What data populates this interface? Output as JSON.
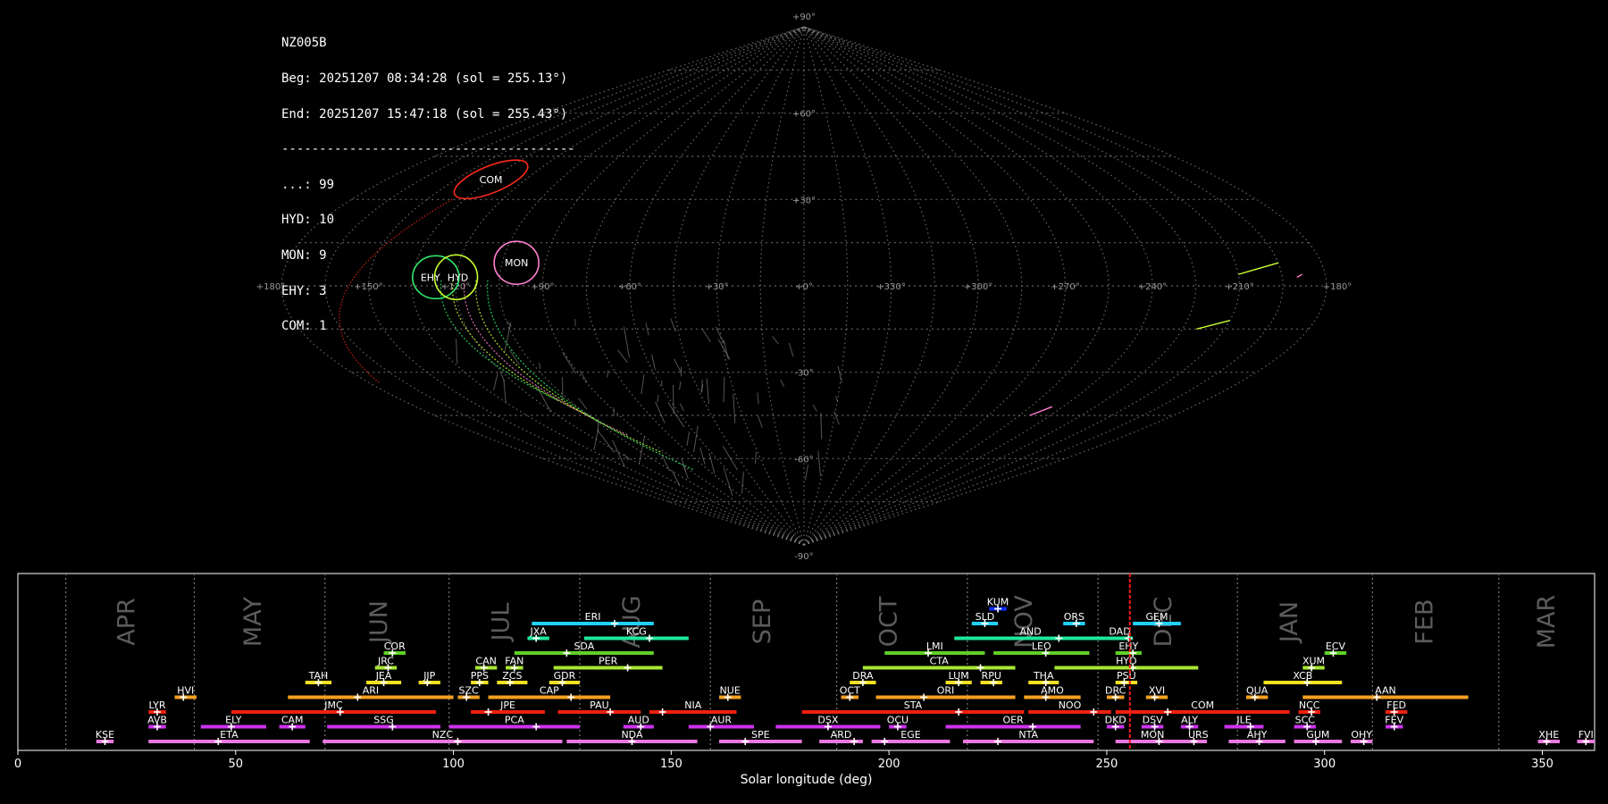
{
  "info": {
    "station": "NZ005B",
    "begin": "Beg: 20251207 08:34:28 (sol = 255.13°)",
    "end": "End: 20251207 15:47:18 (sol = 255.43°)",
    "separator": "---------------------------------------",
    "counts": [
      {
        "label": "...:",
        "value": "99"
      },
      {
        "label": "HYD:",
        "value": "10"
      },
      {
        "label": "MON:",
        "value": "9"
      },
      {
        "label": "EHY:",
        "value": "3"
      },
      {
        "label": "COM:",
        "value": "1"
      }
    ]
  },
  "sky_map": {
    "projection": "sinusoidal",
    "lon_labels": [
      "+180°",
      "+150°",
      "+120°",
      "+90°",
      "+60°",
      "+30°",
      "+0°",
      "+330°",
      "+300°",
      "+270°",
      "+240°",
      "+210°",
      "+180°"
    ],
    "lat_labels": [
      "+90°",
      "+60°",
      "+30°",
      "-30°",
      "-60°",
      "-90°"
    ],
    "radiants": [
      {
        "code": "COM",
        "lon": 135,
        "lat": 37,
        "color": "#ff2a1a"
      },
      {
        "code": "EHY",
        "lon": 127,
        "lat": 3,
        "color": "#2ee86a"
      },
      {
        "code": "HYD",
        "lon": 120,
        "lat": 3,
        "color": "#c8ff30"
      },
      {
        "code": "MON",
        "lon": 100,
        "lat": 8,
        "color": "#ff80d0"
      }
    ]
  },
  "chart_data": {
    "type": "bar",
    "xlabel": "Solar longitude (deg)",
    "xlim": [
      0,
      362
    ],
    "xticks": [
      0,
      50,
      100,
      150,
      200,
      250,
      300,
      350
    ],
    "current_sol": 255.3,
    "months": [
      {
        "name": "APR",
        "center": 25
      },
      {
        "name": "MAY",
        "center": 54
      },
      {
        "name": "JUN",
        "center": 83
      },
      {
        "name": "JUL",
        "center": 111
      },
      {
        "name": "AUG",
        "center": 141
      },
      {
        "name": "SEP",
        "center": 171
      },
      {
        "name": "OCT",
        "center": 200
      },
      {
        "name": "NOV",
        "center": 231
      },
      {
        "name": "DEC",
        "center": 263
      },
      {
        "name": "JAN",
        "center": 292
      },
      {
        "name": "FEB",
        "center": 323
      },
      {
        "name": "MAR",
        "center": 351
      }
    ],
    "month_boundaries": [
      11,
      40.5,
      70.5,
      99,
      129,
      159,
      188,
      218,
      248,
      280,
      311,
      340
    ],
    "showers": [
      {
        "code": "KUM",
        "start": 223,
        "end": 227,
        "peak": 225,
        "row": 9,
        "color": "#1030ff"
      },
      {
        "code": "ERI",
        "start": 118,
        "end": 146,
        "peak": 137,
        "row": 8,
        "color": "#22d0ff"
      },
      {
        "code": "SLD",
        "start": 219,
        "end": 225,
        "peak": 222,
        "row": 8,
        "color": "#22d0ff"
      },
      {
        "code": "ORS",
        "start": 240,
        "end": 245,
        "peak": 243,
        "row": 8,
        "color": "#22d0ff"
      },
      {
        "code": "GEM",
        "start": 256,
        "end": 267,
        "peak": 262,
        "row": 8,
        "color": "#22d0ff"
      },
      {
        "code": "JXA",
        "start": 117,
        "end": 122,
        "peak": 119,
        "row": 7,
        "color": "#20e89a"
      },
      {
        "code": "KCG",
        "start": 130,
        "end": 154,
        "peak": 145,
        "row": 7,
        "color": "#20e89a"
      },
      {
        "code": "AND",
        "start": 215,
        "end": 250,
        "peak": 239,
        "row": 7,
        "color": "#20e89a"
      },
      {
        "code": "DAD",
        "start": 250,
        "end": 256,
        "peak": 255,
        "row": 7,
        "color": "#20e89a"
      },
      {
        "code": "COR",
        "start": 84,
        "end": 89,
        "peak": 86,
        "row": 6,
        "color": "#60d028"
      },
      {
        "code": "SDA",
        "start": 114,
        "end": 146,
        "peak": 126,
        "row": 6,
        "color": "#60d028"
      },
      {
        "code": "LMI",
        "start": 199,
        "end": 222,
        "peak": 209,
        "row": 6,
        "color": "#60d028"
      },
      {
        "code": "LEO",
        "start": 224,
        "end": 246,
        "peak": 236,
        "row": 6,
        "color": "#60d028"
      },
      {
        "code": "EHY",
        "start": 252,
        "end": 258,
        "peak": 256,
        "row": 6,
        "color": "#60d028"
      },
      {
        "code": "ECV",
        "start": 300,
        "end": 305,
        "peak": 302,
        "row": 6,
        "color": "#60d028"
      },
      {
        "code": "JRC",
        "start": 82,
        "end": 87,
        "peak": 85,
        "row": 5,
        "color": "#a8e830"
      },
      {
        "code": "CAN",
        "start": 105,
        "end": 110,
        "peak": 107,
        "row": 5,
        "color": "#a8e830"
      },
      {
        "code": "FAN",
        "start": 112,
        "end": 116,
        "peak": 114,
        "row": 5,
        "color": "#a8e830"
      },
      {
        "code": "PER",
        "start": 123,
        "end": 148,
        "peak": 140,
        "row": 5,
        "color": "#a8e830"
      },
      {
        "code": "CTA",
        "start": 194,
        "end": 229,
        "peak": 221,
        "row": 5,
        "color": "#a8e830"
      },
      {
        "code": "HYD",
        "start": 238,
        "end": 271,
        "peak": 256,
        "row": 5,
        "color": "#a8e830"
      },
      {
        "code": "XUM",
        "start": 295,
        "end": 300,
        "peak": 297,
        "row": 5,
        "color": "#a8e830"
      },
      {
        "code": "TAH",
        "start": 66,
        "end": 72,
        "peak": 69,
        "row": 4,
        "color": "#f0e020"
      },
      {
        "code": "JEA",
        "start": 80,
        "end": 88,
        "peak": 84,
        "row": 4,
        "color": "#f0e020"
      },
      {
        "code": "JIP",
        "start": 92,
        "end": 97,
        "peak": 94,
        "row": 4,
        "color": "#f0e020"
      },
      {
        "code": "PPS",
        "start": 104,
        "end": 108,
        "peak": 106,
        "row": 4,
        "color": "#f0e020"
      },
      {
        "code": "ZCS",
        "start": 110,
        "end": 117,
        "peak": 113,
        "row": 4,
        "color": "#f0e020"
      },
      {
        "code": "GDR",
        "start": 122,
        "end": 129,
        "peak": 125,
        "row": 4,
        "color": "#f0e020"
      },
      {
        "code": "DRA",
        "start": 191,
        "end": 197,
        "peak": 194,
        "row": 4,
        "color": "#f0e020"
      },
      {
        "code": "LUM",
        "start": 213,
        "end": 219,
        "peak": 216,
        "row": 4,
        "color": "#f0e020"
      },
      {
        "code": "RPU",
        "start": 221,
        "end": 226,
        "peak": 224,
        "row": 4,
        "color": "#f0e020"
      },
      {
        "code": "THA",
        "start": 232,
        "end": 239,
        "peak": 236,
        "row": 4,
        "color": "#f0e020"
      },
      {
        "code": "PSU",
        "start": 252,
        "end": 257,
        "peak": 254,
        "row": 4,
        "color": "#f0e020"
      },
      {
        "code": "XCB",
        "start": 286,
        "end": 304,
        "peak": 296,
        "row": 4,
        "color": "#f0e020"
      },
      {
        "code": "HVI",
        "start": 36,
        "end": 41,
        "peak": 38,
        "row": 3,
        "color": "#f5a020"
      },
      {
        "code": "ARI",
        "start": 62,
        "end": 100,
        "peak": 78,
        "row": 3,
        "color": "#f5a020"
      },
      {
        "code": "SZC",
        "start": 101,
        "end": 106,
        "peak": 103,
        "row": 3,
        "color": "#f5a020"
      },
      {
        "code": "CAP",
        "start": 108,
        "end": 136,
        "peak": 127,
        "row": 3,
        "color": "#f5a020"
      },
      {
        "code": "NUE",
        "start": 161,
        "end": 166,
        "peak": 163,
        "row": 3,
        "color": "#f5a020"
      },
      {
        "code": "OCT",
        "start": 189,
        "end": 193,
        "peak": 191,
        "row": 3,
        "color": "#f5a020"
      },
      {
        "code": "ORI",
        "start": 197,
        "end": 229,
        "peak": 208,
        "row": 3,
        "color": "#f5a020"
      },
      {
        "code": "AMO",
        "start": 231,
        "end": 244,
        "peak": 236,
        "row": 3,
        "color": "#f5a020"
      },
      {
        "code": "DRC",
        "start": 250,
        "end": 254,
        "peak": 252,
        "row": 3,
        "color": "#f5a020"
      },
      {
        "code": "XVI",
        "start": 259,
        "end": 264,
        "peak": 261,
        "row": 3,
        "color": "#f5a020"
      },
      {
        "code": "QUA",
        "start": 282,
        "end": 287,
        "peak": 284,
        "row": 3,
        "color": "#f5a020"
      },
      {
        "code": "AAN",
        "start": 295,
        "end": 333,
        "peak": 312,
        "row": 3,
        "color": "#f5a020"
      },
      {
        "code": "LYR",
        "start": 30,
        "end": 34,
        "peak": 32,
        "row": 2,
        "color": "#ee2010"
      },
      {
        "code": "JMC",
        "start": 49,
        "end": 96,
        "peak": 74,
        "row": 2,
        "color": "#ee2010"
      },
      {
        "code": "JPE",
        "start": 104,
        "end": 121,
        "peak": 108,
        "row": 2,
        "color": "#ee2010"
      },
      {
        "code": "PAU",
        "start": 124,
        "end": 143,
        "peak": 136,
        "row": 2,
        "color": "#ee2010"
      },
      {
        "code": "NIA",
        "start": 145,
        "end": 165,
        "peak": 148,
        "row": 2,
        "color": "#ee2010"
      },
      {
        "code": "STA",
        "start": 180,
        "end": 231,
        "peak": 216,
        "row": 2,
        "color": "#ee2010"
      },
      {
        "code": "NOO",
        "start": 232,
        "end": 251,
        "peak": 247,
        "row": 2,
        "color": "#ee2010"
      },
      {
        "code": "COM",
        "start": 252,
        "end": 292,
        "peak": 264,
        "row": 2,
        "color": "#ee2010"
      },
      {
        "code": "NCC",
        "start": 294,
        "end": 299,
        "peak": 297,
        "row": 2,
        "color": "#ee2010"
      },
      {
        "code": "FED",
        "start": 314,
        "end": 319,
        "peak": 316,
        "row": 2,
        "color": "#ee2010"
      },
      {
        "code": "AVB",
        "start": 30,
        "end": 34,
        "peak": 32,
        "row": 1,
        "color": "#cc33ee"
      },
      {
        "code": "ELY",
        "start": 42,
        "end": 57,
        "peak": 49,
        "row": 1,
        "color": "#cc33ee"
      },
      {
        "code": "CAM",
        "start": 60,
        "end": 66,
        "peak": 63,
        "row": 1,
        "color": "#cc33ee"
      },
      {
        "code": "SSG",
        "start": 71,
        "end": 97,
        "peak": 86,
        "row": 1,
        "color": "#cc33ee"
      },
      {
        "code": "PCA",
        "start": 99,
        "end": 129,
        "peak": 119,
        "row": 1,
        "color": "#cc33ee"
      },
      {
        "code": "AUD",
        "start": 139,
        "end": 146,
        "peak": 143,
        "row": 1,
        "color": "#cc33ee"
      },
      {
        "code": "AUR",
        "start": 154,
        "end": 169,
        "peak": 159,
        "row": 1,
        "color": "#cc33ee"
      },
      {
        "code": "DSX",
        "start": 174,
        "end": 198,
        "peak": 186,
        "row": 1,
        "color": "#cc33ee"
      },
      {
        "code": "OCU",
        "start": 200,
        "end": 204,
        "peak": 202,
        "row": 1,
        "color": "#cc33ee"
      },
      {
        "code": "OER",
        "start": 213,
        "end": 244,
        "peak": 233,
        "row": 1,
        "color": "#cc33ee"
      },
      {
        "code": "DKD",
        "start": 250,
        "end": 254,
        "peak": 252,
        "row": 1,
        "color": "#cc33ee"
      },
      {
        "code": "DSV",
        "start": 258,
        "end": 263,
        "peak": 261,
        "row": 1,
        "color": "#cc33ee"
      },
      {
        "code": "ALY",
        "start": 267,
        "end": 271,
        "peak": 269,
        "row": 1,
        "color": "#cc33ee"
      },
      {
        "code": "JLE",
        "start": 277,
        "end": 286,
        "peak": 283,
        "row": 1,
        "color": "#cc33ee"
      },
      {
        "code": "SCC",
        "start": 293,
        "end": 298,
        "peak": 296,
        "row": 1,
        "color": "#cc33ee"
      },
      {
        "code": "FEV",
        "start": 314,
        "end": 318,
        "peak": 316,
        "row": 1,
        "color": "#cc33ee"
      },
      {
        "code": "KSE",
        "start": 18,
        "end": 22,
        "peak": 20,
        "row": 0,
        "color": "#e878e0"
      },
      {
        "code": "ETA",
        "start": 30,
        "end": 67,
        "peak": 46,
        "row": 0,
        "color": "#e878e0"
      },
      {
        "code": "NZC",
        "start": 70,
        "end": 125,
        "peak": 101,
        "row": 0,
        "color": "#e878e0"
      },
      {
        "code": "NDA",
        "start": 126,
        "end": 156,
        "peak": 141,
        "row": 0,
        "color": "#e878e0"
      },
      {
        "code": "SPE",
        "start": 161,
        "end": 180,
        "peak": 167,
        "row": 0,
        "color": "#e878e0"
      },
      {
        "code": "ARD",
        "start": 184,
        "end": 194,
        "peak": 192,
        "row": 0,
        "color": "#e878e0"
      },
      {
        "code": "EGE",
        "start": 196,
        "end": 214,
        "peak": 199,
        "row": 0,
        "color": "#e878e0"
      },
      {
        "code": "NTA",
        "start": 217,
        "end": 247,
        "peak": 225,
        "row": 0,
        "color": "#e878e0"
      },
      {
        "code": "MON",
        "start": 252,
        "end": 269,
        "peak": 262,
        "row": 0,
        "color": "#e878e0"
      },
      {
        "code": "URS",
        "start": 269,
        "end": 273,
        "peak": 270,
        "row": 0,
        "color": "#e878e0"
      },
      {
        "code": "AHY",
        "start": 278,
        "end": 291,
        "peak": 285,
        "row": 0,
        "color": "#e878e0"
      },
      {
        "code": "GUM",
        "start": 293,
        "end": 304,
        "peak": 298,
        "row": 0,
        "color": "#e878e0"
      },
      {
        "code": "OHY",
        "start": 306,
        "end": 311,
        "peak": 309,
        "row": 0,
        "color": "#e878e0"
      },
      {
        "code": "XHE",
        "start": 349,
        "end": 354,
        "peak": 351,
        "row": 0,
        "color": "#e878e0"
      },
      {
        "code": "FVI",
        "start": 358,
        "end": 362,
        "peak": 360,
        "row": 0,
        "color": "#e878e0"
      }
    ]
  }
}
